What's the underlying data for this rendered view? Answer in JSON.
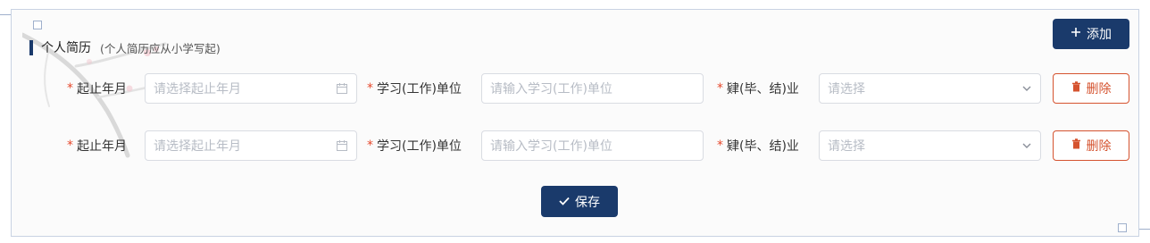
{
  "section": {
    "title": "个人简历",
    "subtitle": "(个人简历应从小学写起)"
  },
  "buttons": {
    "add_label": "添加",
    "add_icon": "plus-icon",
    "save_label": "保存",
    "save_icon": "check-icon"
  },
  "colors": {
    "primary": "#1a3a6b",
    "danger": "#d5532f",
    "required": "#e6492d"
  },
  "entries": [
    {
      "date_label": "起止年月",
      "date_placeholder": "请选择起止年月",
      "unit_label": "学习(工作)单位",
      "unit_placeholder": "请输入学习(工作)单位",
      "status_label": "肄(毕、结)业",
      "status_placeholder": "请选择",
      "delete_label": "删除"
    },
    {
      "date_label": "起止年月",
      "date_placeholder": "请选择起止年月",
      "unit_label": "学习(工作)单位",
      "unit_placeholder": "请输入学习(工作)单位",
      "status_label": "肄(毕、结)业",
      "status_placeholder": "请选择",
      "delete_label": "删除"
    }
  ]
}
